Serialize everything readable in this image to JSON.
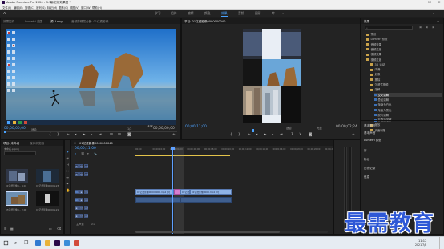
{
  "window": {
    "title": "Adobe Premiere Pro 2020 - D:\\最\\亿前效果图 *",
    "min": "—",
    "max": "☐",
    "close": "✕"
  },
  "menu": [
    "文件(F)",
    "编辑(E)",
    "剪辑(C)",
    "序列(S)",
    "标记(M)",
    "图形(G)",
    "视图(V)",
    "窗口(W)",
    "帮助(H)"
  ],
  "workspaces": [
    "学习",
    "组件",
    "编辑",
    "颜色",
    "效果",
    "音频",
    "图形",
    "库"
  ],
  "active_workspace": "效果",
  "source_panel": {
    "tabs": [
      "效果控件",
      "Lumetri 范围",
      "源: Long",
      "音频剪辑混合器: 01亿费影像"
    ],
    "active_tab": "源: Long",
    "timecode_left": "00;00;00;00",
    "fit": "适合",
    "ratio": "1/2",
    "timecode_right": "00;00;00;00",
    "desktop_clock": "11:12",
    "desktop_date": "2021/7/8"
  },
  "program_panel": {
    "tab": "节目: 01亿费影像0000000040",
    "timecode_left": "00;00;11;00",
    "fit": "适合",
    "ratio": "完整",
    "timecode_right": "00;00;02;24"
  },
  "project_panel": {
    "tabs": [
      "项目: 未命名",
      "媒体浏览器"
    ],
    "path": "未命名.prproj",
    "items": [
      {
        "name": "01亿费影像0...",
        "duration": "4;03"
      },
      {
        "name": "01亿费影像0000...",
        "duration": "4;23"
      },
      {
        "name": "05亿费影像0...",
        "duration": "2;00"
      },
      {
        "name": "01亿费影像0000...",
        "duration": "4;21"
      }
    ]
  },
  "effects_panel": {
    "title": "效果",
    "items": [
      {
        "label": "预设",
        "indent": 0,
        "type": "folder"
      },
      {
        "label": "Lumetri 预设",
        "indent": 0,
        "type": "folder"
      },
      {
        "label": "音频效果",
        "indent": 0,
        "type": "folder"
      },
      {
        "label": "音频过渡",
        "indent": 0,
        "type": "folder"
      },
      {
        "label": "视频效果",
        "indent": 0,
        "type": "folder"
      },
      {
        "label": "视频过渡",
        "indent": 0,
        "type": "folder"
      },
      {
        "label": "3D 运动",
        "indent": 1,
        "type": "folder"
      },
      {
        "label": "内滑",
        "indent": 1,
        "type": "folder"
      },
      {
        "label": "划像",
        "indent": 1,
        "type": "folder"
      },
      {
        "label": "擦除",
        "indent": 1,
        "type": "folder"
      },
      {
        "label": "沉浸式视频",
        "indent": 1,
        "type": "folder"
      },
      {
        "label": "溶解",
        "indent": 1,
        "type": "folder"
      },
      {
        "label": "交叉溶解",
        "indent": 2,
        "type": "fx",
        "selected": true
      },
      {
        "label": "叠加溶解",
        "indent": 2,
        "type": "fx"
      },
      {
        "label": "渐隐为白色",
        "indent": 2,
        "type": "fx"
      },
      {
        "label": "渐隐为黑色",
        "indent": 2,
        "type": "fx"
      },
      {
        "label": "胶片溶解",
        "indent": 2,
        "type": "fx"
      },
      {
        "label": "非叠加溶解",
        "indent": 2,
        "type": "fx"
      },
      {
        "label": "缩放",
        "indent": 1,
        "type": "folder"
      },
      {
        "label": "页面剥落",
        "indent": 1,
        "type": "folder"
      }
    ],
    "sections": [
      "基本图形",
      "基本声音",
      "Lumetri 颜色",
      "库",
      "标记",
      "历史记录",
      "信息"
    ]
  },
  "timeline": {
    "tab": "01亿费影像0000000040",
    "timecode": "00;00;11;00",
    "ruler": [
      "00;00",
      "00;00;02;00",
      "00;00;04;00",
      "00;00;06;00",
      "00;00;08;00",
      "00;00;10;00",
      "00;00;12;00",
      "00;00;14;00",
      "00;00;16;00",
      "00;00;18;00",
      "00;00;20;00",
      "00;00;22;00"
    ],
    "tracks": [
      "V3",
      "V2",
      "V1",
      "A1",
      "A2",
      "A3"
    ],
    "master": "主声道",
    "master_value": "0.0",
    "clips": {
      "v1_a": "01亿费影像00000000.mp4 [V]",
      "v1_b": "01亿费",
      "v1_c": "01亿费影像0000.mp4 [V]",
      "a1_a": "",
      "a1_b": ""
    }
  },
  "watermark": "最需教育",
  "taskbar": {
    "time": "11:12",
    "date": "2021/7/8"
  },
  "colors": {
    "accent": "#4aa3ff",
    "clip_video": "#8fb3e6",
    "clip_audio": "#3f5f8f",
    "transition": "#d77fcf",
    "playhead": "#5ea0ff"
  }
}
